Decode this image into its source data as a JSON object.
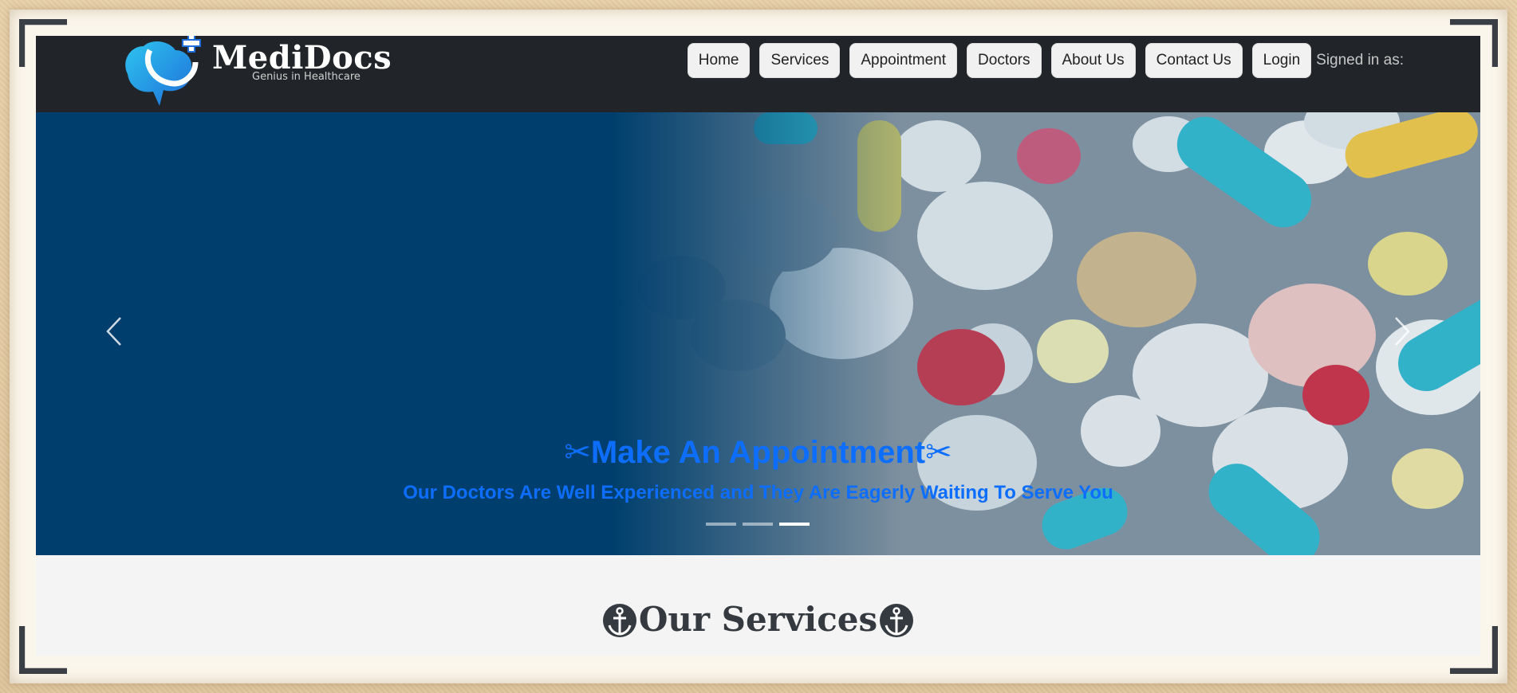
{
  "brand": {
    "name": "MediDocs",
    "tagline": "Genius in Healthcare"
  },
  "nav": {
    "items": [
      {
        "label": "Home"
      },
      {
        "label": "Services"
      },
      {
        "label": "Appointment"
      },
      {
        "label": "Doctors"
      },
      {
        "label": "About Us"
      },
      {
        "label": "Contact Us"
      },
      {
        "label": "Login"
      }
    ],
    "signed_in_text": "Signed in as:"
  },
  "carousel": {
    "title": "☌—Make An Appointment☌—",
    "title_text": "Make An Appointment",
    "subtitle": "Our Doctors Are Well Experienced and They Are Eagerly Waiting To Serve You",
    "prev_icon": "chevron-left-icon",
    "next_icon": "chevron-right-icon",
    "slides_count": 3,
    "active_slide": 3
  },
  "services": {
    "heading": "Our Services",
    "icon": "anchor-icon"
  },
  "colors": {
    "navbar": "#212529",
    "caption": "#0d6efd",
    "hero_blue": "#003f6d",
    "heading": "#343a40"
  }
}
